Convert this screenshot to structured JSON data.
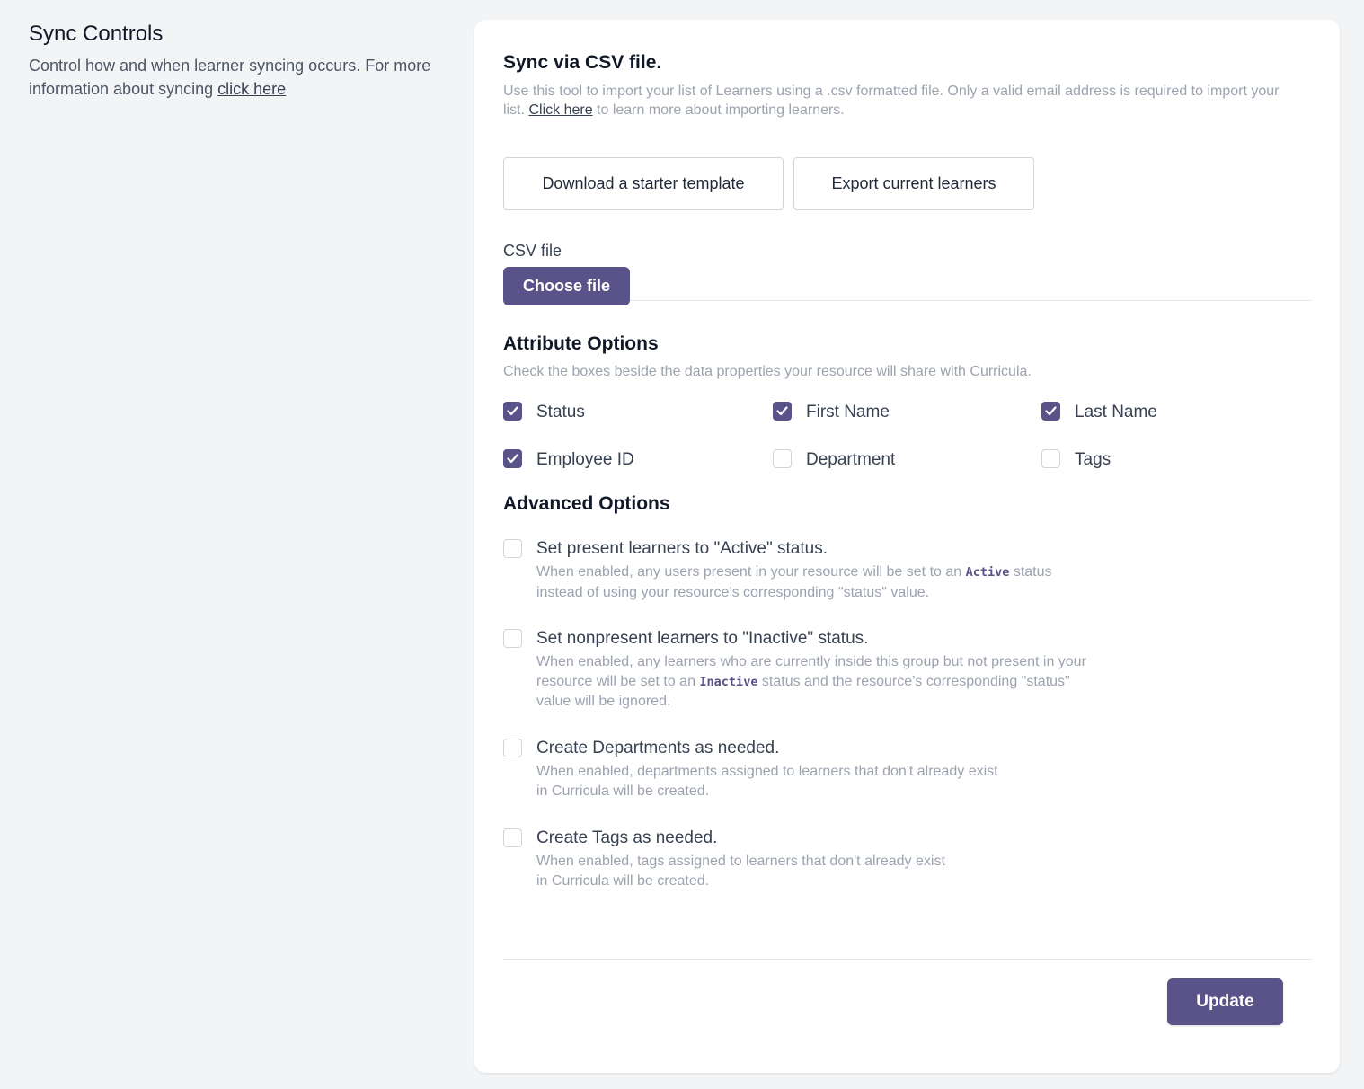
{
  "sidebar": {
    "title": "Sync Controls",
    "description": "Control how and when learner syncing occurs. For more information about syncing ",
    "link": "click here"
  },
  "csv": {
    "title": "Sync via CSV file.",
    "description_1": "Use this tool to import your list of Learners using a .csv formatted file. Only a valid email address is required to import your list. ",
    "description_link": "Click here",
    "description_2": " to learn more about importing learners.",
    "download_button": "Download a starter template",
    "export_button": "Export current learners",
    "file_label": "CSV file",
    "choose_file_button": "Choose file"
  },
  "attributes": {
    "title": "Attribute Options",
    "description": "Check the boxes beside the data properties your resource will share with Curricula.",
    "items": [
      {
        "label": "Status",
        "checked": true
      },
      {
        "label": "First Name",
        "checked": true
      },
      {
        "label": "Last Name",
        "checked": true
      },
      {
        "label": "Employee ID",
        "checked": true
      },
      {
        "label": "Department",
        "checked": false
      },
      {
        "label": "Tags",
        "checked": false
      }
    ]
  },
  "advanced": {
    "title": "Advanced Options",
    "options": [
      {
        "label": "Set present learners to \"Active\" status.",
        "checked": false,
        "help_1": "When enabled, any users present in your resource will be set to an ",
        "help_code": "Active",
        "help_2": " status instead of using your resource’s corresponding \"status\" value."
      },
      {
        "label": "Set nonpresent learners to \"Inactive\" status.",
        "checked": false,
        "help_1": "When enabled, any learners who are currently inside this group but not present in your resource will be set to an ",
        "help_code": "Inactive",
        "help_2": " status and the resource’s corresponding \"status\" value will be ignored."
      },
      {
        "label": "Create Departments as needed.",
        "checked": false,
        "help_1": "When enabled, departments assigned to learners that don't already exist in Curricula will be created.",
        "help_code": "",
        "help_2": ""
      },
      {
        "label": "Create Tags as needed.",
        "checked": false,
        "help_1": "When enabled, tags assigned to learners that don't already exist in Curricula will be created.",
        "help_code": "",
        "help_2": ""
      }
    ]
  },
  "footer": {
    "update_button": "Update"
  },
  "colors": {
    "accent": "#5a5389",
    "background": "#f3f4f6",
    "card": "#ffffff",
    "muted_text": "#9ca3af"
  }
}
